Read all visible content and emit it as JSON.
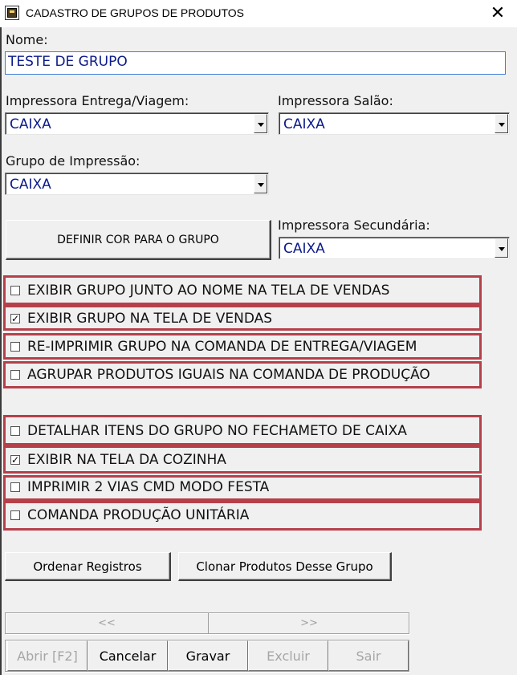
{
  "window": {
    "title": "CADASTRO DE GRUPOS DE PRODUTOS",
    "close_glyph": "✕",
    "icon": "app-icon"
  },
  "form": {
    "nome_label": "Nome:",
    "nome_value": "TESTE DE GRUPO",
    "impressora_entrega_label": "Impressora Entrega/Viagem:",
    "impressora_entrega_value": "CAIXA",
    "impressora_salao_label": "Impressora Salão:",
    "impressora_salao_value": "CAIXA",
    "grupo_impressao_label": "Grupo de Impressão:",
    "grupo_impressao_value": "CAIXA",
    "definir_cor_label": "DEFINIR COR PARA O GRUPO",
    "impressora_secundaria_label": "Impressora Secundária:",
    "impressora_secundaria_value": "CAIXA"
  },
  "checkboxes_group1": [
    {
      "label": "EXIBIR GRUPO JUNTO AO NOME NA TELA DE VENDAS",
      "checked": false,
      "mark": ""
    },
    {
      "label": "EXIBIR GRUPO NA TELA DE VENDAS",
      "checked": true,
      "mark": "✓"
    },
    {
      "label": "RE-IMPRIMIR GRUPO NA COMANDA DE ENTREGA/VIAGEM",
      "checked": false,
      "mark": ""
    },
    {
      "label": "AGRUPAR PRODUTOS IGUAIS NA COMANDA DE PRODUÇÃO",
      "checked": false,
      "mark": ""
    }
  ],
  "checkboxes_group2": [
    {
      "label": "DETALHAR ITENS DO GRUPO NO FECHAMETO DE CAIXA",
      "checked": false,
      "mark": ""
    },
    {
      "label": "EXIBIR NA TELA DA COZINHA",
      "checked": true,
      "mark": "✓"
    },
    {
      "label": "IMPRIMIR 2 VIAS CMD MODO FESTA",
      "checked": false,
      "mark": ""
    },
    {
      "label": "COMANDA PRODUÇÃO UNITÁRIA",
      "checked": false,
      "mark": ""
    }
  ],
  "actions": {
    "ordenar_label": "Ordenar Registros",
    "clonar_label": "Clonar Produtos Desse Grupo"
  },
  "navigation": {
    "prev_label": "<<",
    "next_label": ">>"
  },
  "bottom_buttons": [
    {
      "label": "Abrir [F2]",
      "enabled": false
    },
    {
      "label": "Cancelar",
      "enabled": true
    },
    {
      "label": "Gravar",
      "enabled": true
    },
    {
      "label": "Excluir",
      "enabled": false
    },
    {
      "label": "Sair",
      "enabled": false
    }
  ],
  "colors": {
    "highlight_border": "#b5404a",
    "field_text": "#0b1a8a"
  }
}
